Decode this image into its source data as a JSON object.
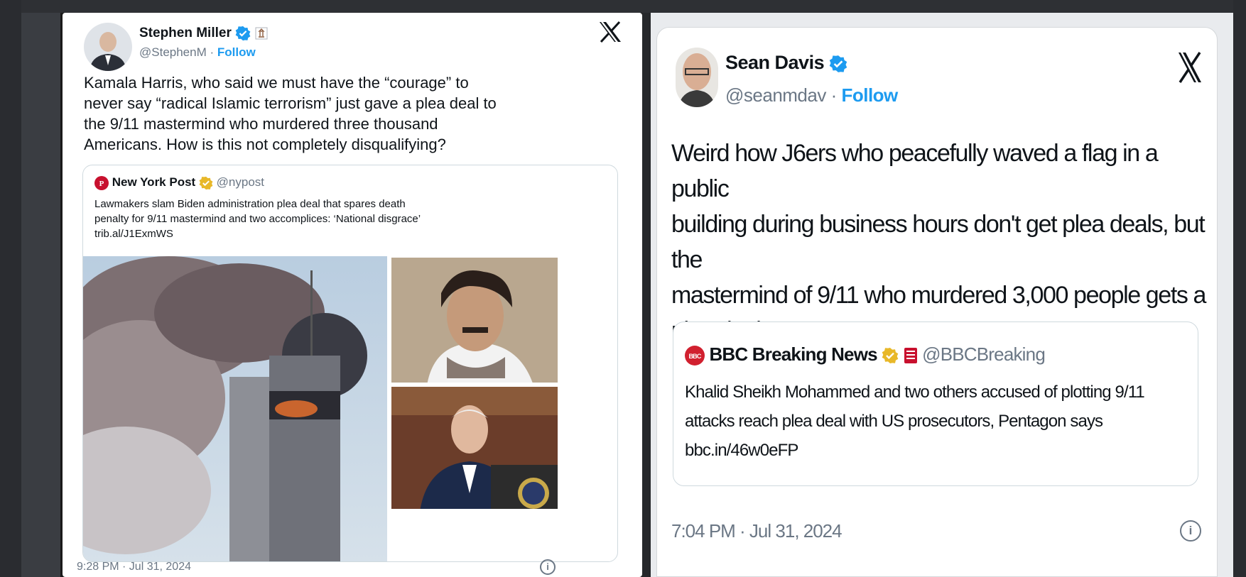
{
  "left_tweet": {
    "author_name": "Stephen Miller",
    "author_handle": "@StephenM",
    "follow_label": "Follow",
    "separator": " · ",
    "x_logo": "𝕏",
    "text_lines": [
      "Kamala Harris, who said we must have the “courage” to",
      "never say “radical Islamic terrorism” just gave a plea deal to",
      "the 9/11 mastermind who murdered three thousand",
      "Americans. How is this not completely disqualifying?"
    ],
    "quote": {
      "source_name": "New York Post",
      "source_handle": "@nypost",
      "headline_lines": [
        "Lawmakers slam Biden administration plea deal that spares death",
        "penalty for 9/11 mastermind and two accomplices: ‘National disgrace’"
      ],
      "link": "trib.al/J1ExmWS"
    },
    "timestamp": "9:28 PM · Jul 31, 2024",
    "info_icon": "i"
  },
  "right_tweet": {
    "author_name": "Sean Davis",
    "author_handle": "@seanmdav",
    "follow_label": "Follow",
    "separator": " · ",
    "x_logo": "𝕏",
    "text_lines": [
      "Weird how J6ers who peacefully waved a flag in a public",
      "building during business hours don't get plea deals, but the",
      "mastermind of 9/11 who murdered 3,000 people gets a",
      "plea deal."
    ],
    "quote": {
      "source_name": "BBC Breaking News",
      "source_handle": "@BBCBreaking",
      "headline_lines": [
        "Khalid Sheikh Mohammed and two others accused of plotting 9/11",
        "attacks reach plea deal with US prosecutors, Pentagon says"
      ],
      "link": "bbc.in/46w0eFP"
    },
    "timestamp": "7:04 PM · Jul 31, 2024",
    "info_icon": "i"
  },
  "colors": {
    "link_blue": "#1d9bf0",
    "verified_blue": "#1d9bf0",
    "verified_gold": "#e8b829",
    "text_dark": "#0f1419",
    "muted": "#6b7785"
  },
  "icons": {
    "verified": "verified-badge-icon",
    "gold_verified": "gold-verified-badge-icon",
    "x": "x-logo-icon",
    "info": "info-icon"
  }
}
